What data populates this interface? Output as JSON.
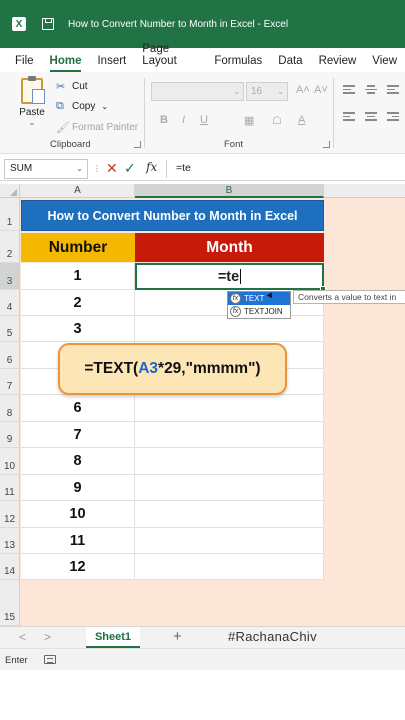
{
  "window": {
    "title": "How to Convert Number to Month in Excel  -  Excel",
    "app_icon": "excel-logo-icon",
    "save_icon": "save-icon"
  },
  "menu": {
    "tabs": [
      "File",
      "Home",
      "Insert",
      "Page Layout",
      "Formulas",
      "Data",
      "Review",
      "View"
    ],
    "active": "Home"
  },
  "ribbon": {
    "clipboard": {
      "paste_label": "Paste",
      "cut_label": "Cut",
      "copy_label": "Copy",
      "format_painter_label": "Format Painter",
      "group_label": "Clipboard"
    },
    "font": {
      "size_value": "16",
      "grow_glyph": "A˄",
      "shrink_glyph": "A˅",
      "group_label": "Font"
    }
  },
  "formula_bar": {
    "name_box": "SUM",
    "formula": "=te",
    "cancel_glyph": "✕",
    "enter_glyph": "✓",
    "fx_glyph": "fx"
  },
  "grid": {
    "columns": [
      "A",
      "B"
    ],
    "selected_column": "B",
    "row_numbers": [
      "1",
      "2",
      "3",
      "4",
      "5",
      "6",
      "7",
      "8",
      "9",
      "10",
      "11",
      "12",
      "13",
      "14",
      "15"
    ],
    "selected_row": "3",
    "banner": "How to Convert Number to Month in Excel",
    "header_number": "Number",
    "header_month": "Month",
    "numbers": [
      "1",
      "2",
      "3",
      "",
      "",
      "6",
      "7",
      "8",
      "9",
      "10",
      "11",
      "12"
    ],
    "active_cell_text": "=te"
  },
  "autocomplete": {
    "items": [
      "TEXT",
      "TEXTJOIN"
    ],
    "selected": "TEXT",
    "tooltip": "Converts a value to text in"
  },
  "callout": {
    "prefix": "=TEXT(",
    "ref": "A3",
    "suffix": "*29,\"mmmm\")"
  },
  "sheets": {
    "tabs": [
      "Sheet1"
    ],
    "active": "Sheet1",
    "add_glyph": "+",
    "prev_glyph": "<",
    "next_glyph": ">",
    "watermark": "#RachanaChiv"
  },
  "status": {
    "mode": "Enter"
  },
  "colors": {
    "excel_green": "#217346",
    "banner_blue": "#1f6fbf",
    "number_header": "#f5b800",
    "month_header": "#c81a08",
    "callout_fill": "#fde6b6",
    "callout_border": "#e9953d",
    "background_peach": "#fbe6d8"
  }
}
